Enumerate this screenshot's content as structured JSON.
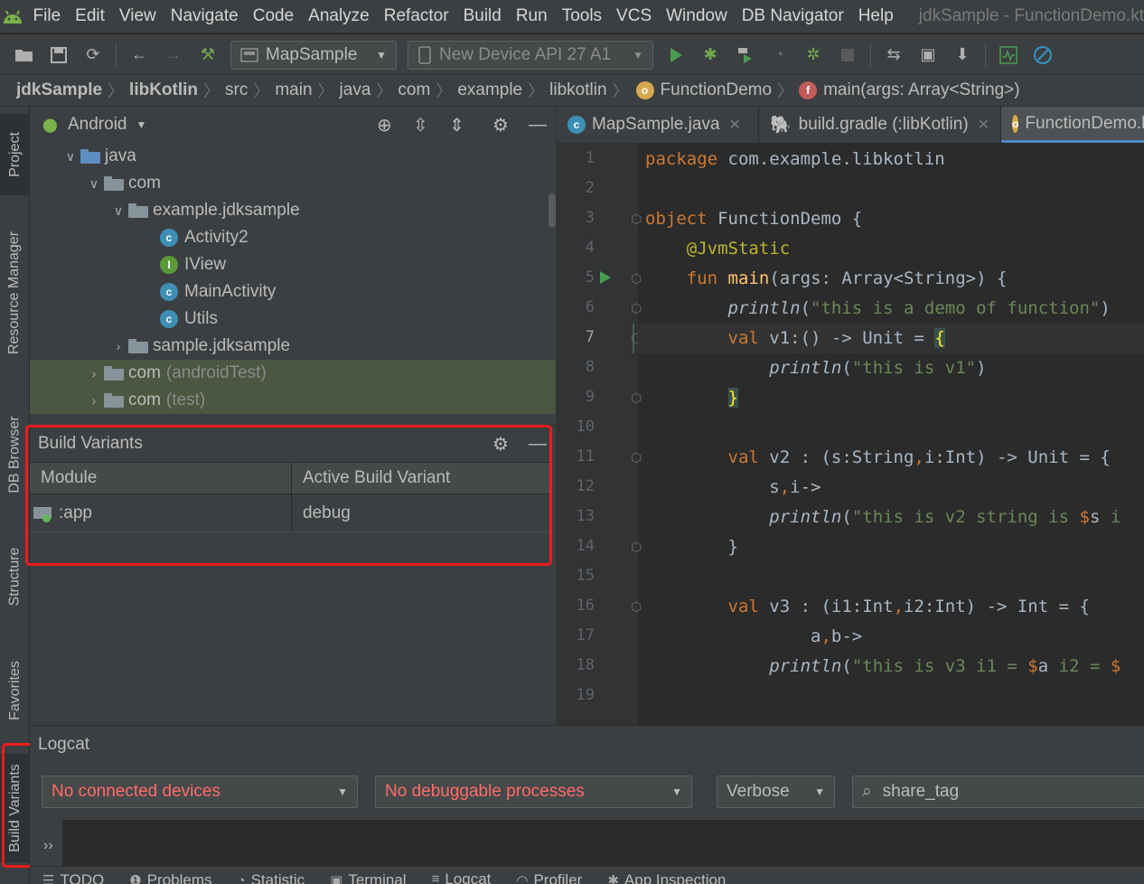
{
  "menu": {
    "items": [
      "File",
      "Edit",
      "View",
      "Navigate",
      "Code",
      "Analyze",
      "Refactor",
      "Build",
      "Run",
      "Tools",
      "VCS",
      "Window",
      "DB Navigator",
      "Help"
    ],
    "window_title": "jdkSample - FunctionDemo.kt"
  },
  "toolbar": {
    "run_config": "MapSample",
    "device": "New Device API 27 A1"
  },
  "breadcrumb": [
    "jdkSample",
    "libKotlin",
    "src",
    "main",
    "java",
    "com",
    "example",
    "libkotlin",
    "FunctionDemo",
    "main(args: Array<String>)"
  ],
  "left_strip": {
    "project": "Project",
    "resource_manager": "Resource Manager",
    "db_browser": "DB Browser",
    "structure": "Structure",
    "favorites": "Favorites",
    "build_variants": "Build Variants"
  },
  "project_panel": {
    "view_mode": "Android",
    "tree": [
      {
        "label": "java",
        "suffix": ""
      },
      {
        "label": "com",
        "suffix": ""
      },
      {
        "label": "example.jdksample",
        "suffix": ""
      },
      {
        "label": "Activity2",
        "suffix": ""
      },
      {
        "label": "IView",
        "suffix": ""
      },
      {
        "label": "MainActivity",
        "suffix": ""
      },
      {
        "label": "Utils",
        "suffix": ""
      },
      {
        "label": "sample.jdksample",
        "suffix": ""
      },
      {
        "label": "com",
        "suffix": "(androidTest)"
      },
      {
        "label": "com",
        "suffix": "(test)"
      }
    ]
  },
  "build_variants": {
    "title": "Build Variants",
    "col_module": "Module",
    "col_variant": "Active Build Variant",
    "rows": [
      {
        "module": ":app",
        "variant": "debug"
      }
    ]
  },
  "editor": {
    "tabs": [
      "MapSample.java",
      "build.gradle (:libKotlin)",
      "FunctionDemo.kt"
    ],
    "line_numbers": [
      "1",
      "2",
      "3",
      "4",
      "5",
      "6",
      "7",
      "8",
      "9",
      "10",
      "11",
      "12",
      "13",
      "14",
      "15",
      "16",
      "17",
      "18",
      "19"
    ],
    "current_line": 7
  },
  "logcat": {
    "title": "Logcat",
    "device": "No connected devices",
    "process": "No debuggable processes",
    "level": "Verbose",
    "search": "share_tag",
    "expand": "››"
  },
  "bottom_tabs": [
    "TODO",
    "Problems",
    "Statistic",
    "Terminal",
    "Logcat",
    "Profiler",
    "App Inspection"
  ],
  "colors": {
    "highlight_box": "#ee1c1c",
    "selection_green": "#4b5740",
    "run_green": "#499c54"
  }
}
